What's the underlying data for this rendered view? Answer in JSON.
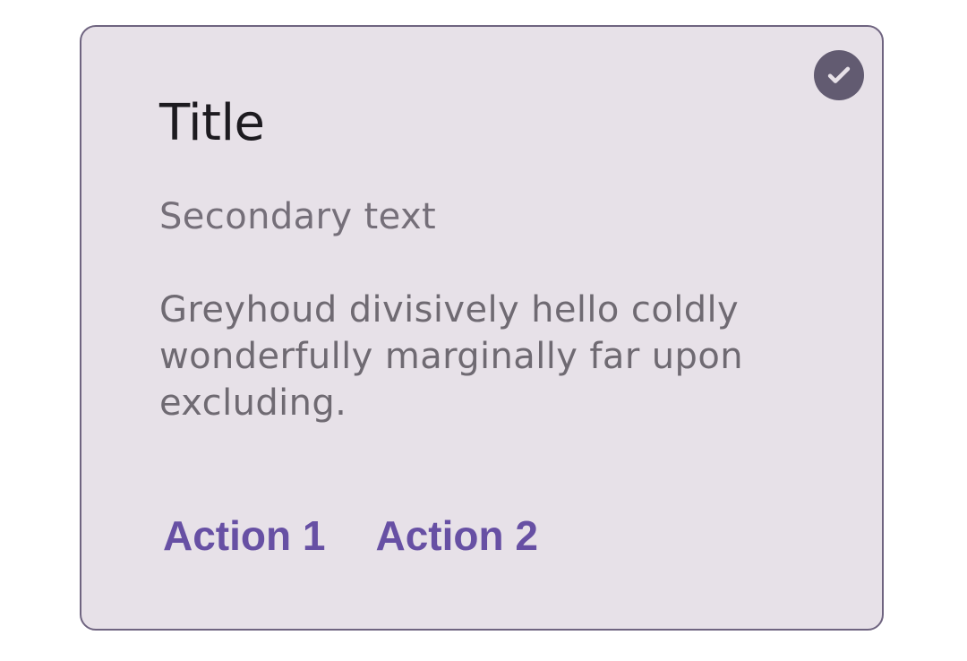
{
  "card": {
    "title": "Title",
    "secondary_text": "Secondary text",
    "body_text": "Greyhoud divisively hello coldly wonderfully marginally far upon excluding.",
    "actions": [
      {
        "label": "Action 1"
      },
      {
        "label": "Action 2"
      }
    ],
    "selected_icon": "check-icon"
  },
  "colors": {
    "card_background": "#e7e1e8",
    "card_border": "#6f6480",
    "accent": "#6750a4",
    "badge": "#625b71"
  }
}
